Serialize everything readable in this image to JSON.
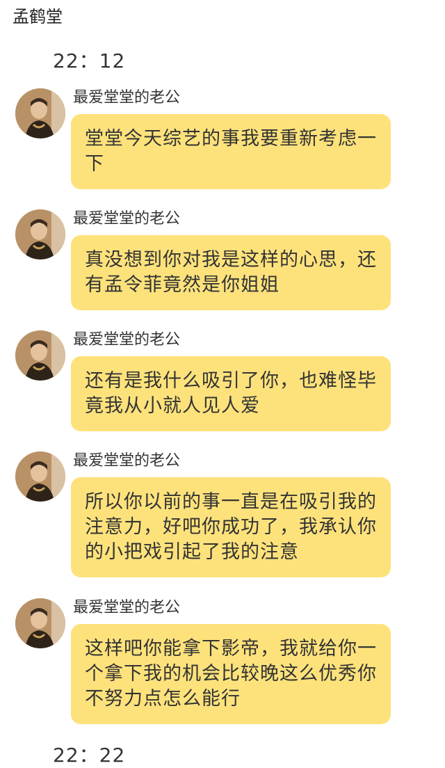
{
  "header": {
    "title": "孟鹤堂"
  },
  "times": [
    "22：12",
    "22：22"
  ],
  "messages": [
    {
      "sender": "最爱堂堂的老公",
      "text": "堂堂今天综艺的事我要重新考虑一下"
    },
    {
      "sender": "最爱堂堂的老公",
      "text": "真没想到你对我是这样的心思，还有孟令菲竟然是你姐姐"
    },
    {
      "sender": "最爱堂堂的老公",
      "text": "还有是我什么吸引了你，也难怪毕竟我从小就人见人爱"
    },
    {
      "sender": "最爱堂堂的老公",
      "text": "所以你以前的事一直是在吸引我的注意力，好吧你成功了，我承认你的小把戏引起了我的注意"
    },
    {
      "sender": "最爱堂堂的老公",
      "text": "这样吧你能拿下影帝，我就给你一个拿下我的机会比较晚这么优秀你不努力点怎么能行"
    }
  ],
  "colors": {
    "bubble": "#fde27c",
    "background": "#ffffff"
  },
  "icons": {
    "avatar": "person-photo-avatar"
  }
}
